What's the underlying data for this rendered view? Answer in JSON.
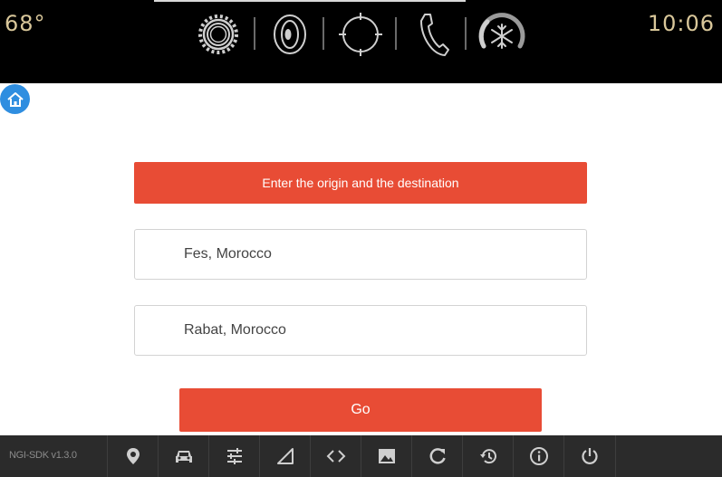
{
  "status_bar": {
    "temperature": "68°",
    "time": "10:06",
    "icons": [
      "settings-gear-icon",
      "speaker-icon",
      "navigation-crosshair-icon",
      "phone-icon",
      "climate-fan-icon"
    ]
  },
  "home": {
    "icon": "home-icon"
  },
  "form": {
    "banner": "Enter the origin and the destination",
    "origin_value": "Fes, Morocco",
    "destination_value": "Rabat, Morocco",
    "go_label": "Go"
  },
  "toolbar": {
    "version": "NGI-SDK v1.3.0",
    "buttons": [
      "location-pin-icon",
      "car-icon",
      "tune-sliders-icon",
      "signal-triangle-icon",
      "code-brackets-icon",
      "image-icon",
      "refresh-icon",
      "history-icon",
      "info-icon",
      "power-icon"
    ]
  },
  "colors": {
    "accent": "#e84c35",
    "home_blue": "#2f8ee0",
    "status_text": "#d9c79a",
    "toolbar_bg": "#2b2b2b"
  }
}
